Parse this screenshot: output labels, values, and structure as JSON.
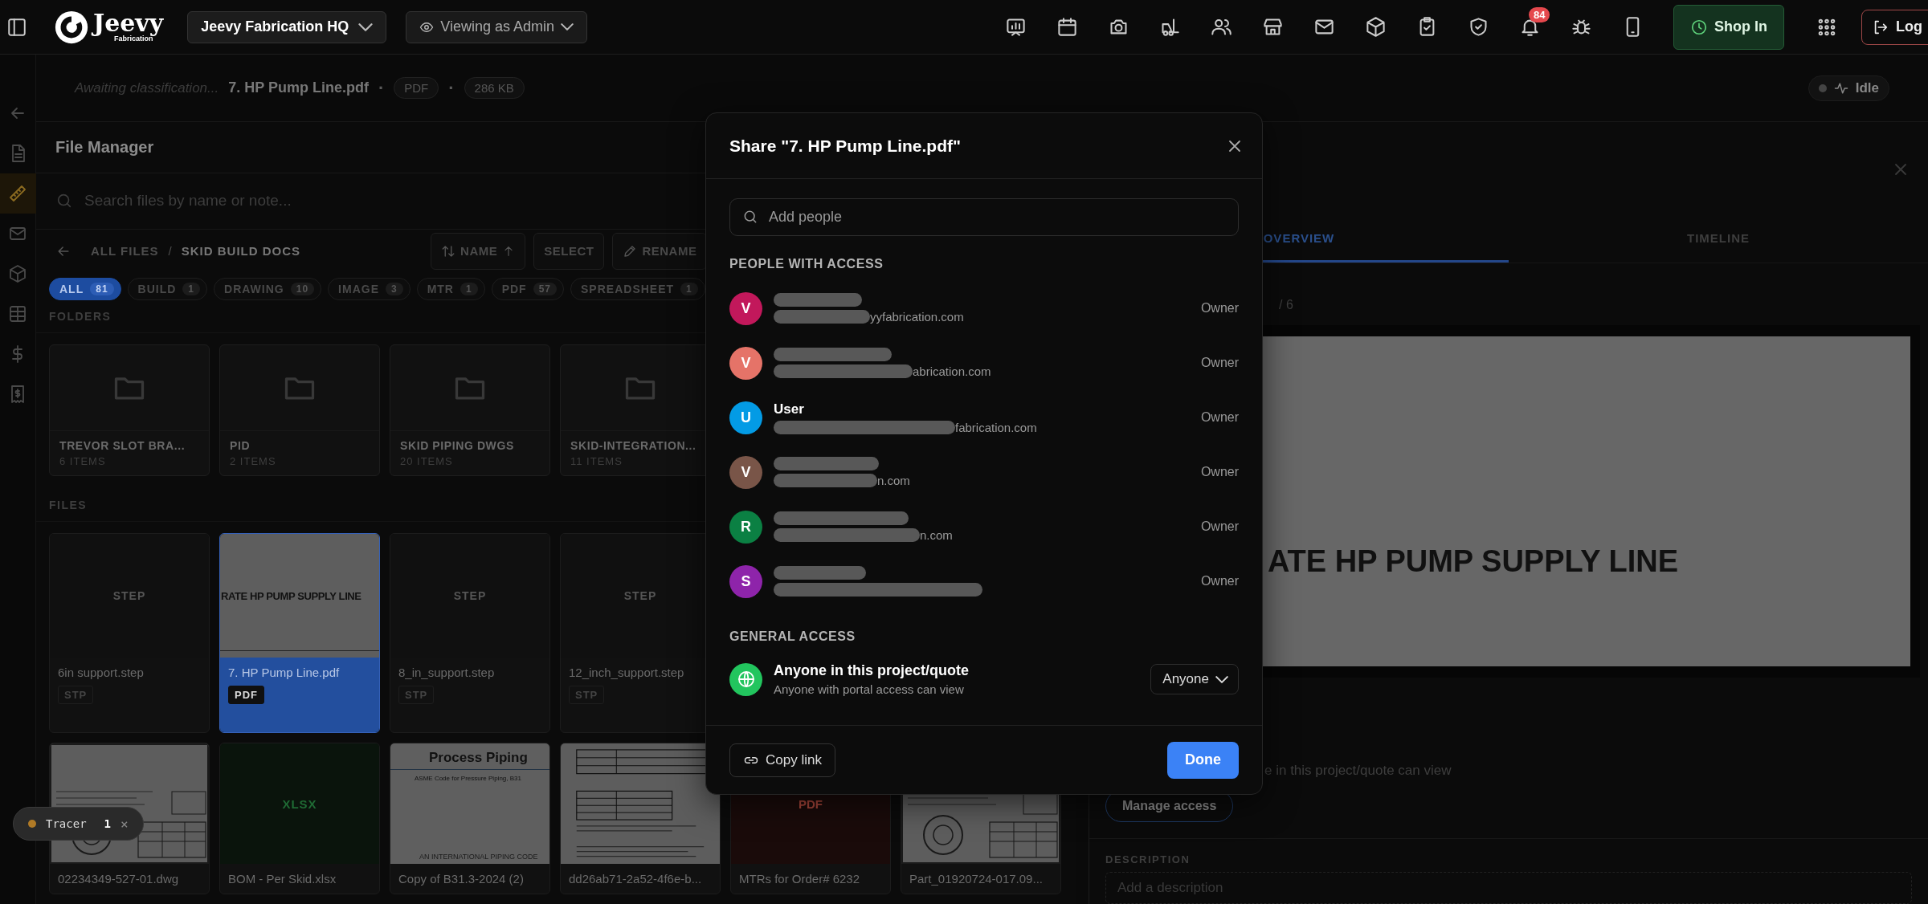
{
  "topbar": {
    "logo": {
      "name": "Jeevy",
      "subtitle": "Fabrication"
    },
    "workspace": "Jeevy Fabrication HQ",
    "view_as": "Viewing as Admin",
    "notification_count": "84",
    "shop_button": "Shop In",
    "logout_button": "Log"
  },
  "rail": {
    "items": [
      {
        "selected": false
      },
      {
        "selected": false
      },
      {
        "selected": true
      },
      {
        "selected": false
      },
      {
        "selected": false
      },
      {
        "selected": false
      },
      {
        "selected": false
      },
      {
        "selected": false
      }
    ]
  },
  "file_header": {
    "status": "Awaiting classification...",
    "file_name": "7. HP Pump Line.pdf",
    "separator_1": "·",
    "type": "PDF",
    "separator_2": "·",
    "size": "286 KB",
    "activity": "Idle"
  },
  "file_manager": {
    "title": "File Manager",
    "search": {
      "placeholder": "Search files by name or note..."
    },
    "breadcrumb": {
      "root": "ALL FILES",
      "separator": "/",
      "current": "SKID BUILD DOCS"
    },
    "toolbar": [
      {
        "label": "NAME",
        "kind": "sort"
      },
      {
        "label": "SELECT",
        "kind": "plain"
      },
      {
        "label": "RENAME",
        "kind": "edit"
      }
    ],
    "filters": [
      {
        "label": "ALL",
        "count": "81",
        "selected": true
      },
      {
        "label": "BUILD",
        "count": "1",
        "selected": false
      },
      {
        "label": "DRAWING",
        "count": "10",
        "selected": false
      },
      {
        "label": "IMAGE",
        "count": "3",
        "selected": false
      },
      {
        "label": "MTR",
        "count": "1",
        "selected": false
      },
      {
        "label": "PDF",
        "count": "57",
        "selected": false
      },
      {
        "label": "SPREADSHEET",
        "count": "1",
        "selected": false
      }
    ],
    "folders_heading": "FOLDERS",
    "folders": [
      {
        "name": "TREVOR SLOT BRA...",
        "count": "6 ITEMS"
      },
      {
        "name": "PID",
        "count": "2 ITEMS"
      },
      {
        "name": "SKID PIPING DWGS",
        "count": "20 ITEMS"
      },
      {
        "name": "SKID-INTEGRATION...",
        "count": "11 ITEMS"
      }
    ],
    "files_heading": "FILES",
    "file_rows": [
      [
        {
          "name": "6in support.step",
          "type": "STP",
          "kind": "step",
          "thumb_text": "STEP",
          "selected": false
        },
        {
          "name": "7. HP Pump Line.pdf",
          "type": "PDF",
          "kind": "title_page",
          "thumb_text": "RATE HP PUMP SUPPLY LINE",
          "selected": true
        },
        {
          "name": "8_in_support.step",
          "type": "STP",
          "kind": "step",
          "thumb_text": "STEP",
          "selected": false
        },
        {
          "name": "12_inch_support.step",
          "type": "STP",
          "kind": "step",
          "thumb_text": "STEP",
          "selected": false
        }
      ],
      [
        {
          "name": "02234349-527-01.dwg",
          "kind": "drawing",
          "selected": false
        },
        {
          "name": "BOM - Per Skid.xlsx",
          "kind": "sheet",
          "thumb_text": "XLSX",
          "selected": false
        },
        {
          "name": "Copy of B31.3-2024 (2)",
          "kind": "cover",
          "thumb_title": "Process Piping",
          "thumb_subtitle": "ASME Code for Pressure Piping, B31",
          "thumb_footer": "AN INTERNATIONAL PIPING CODE",
          "selected": false
        },
        {
          "name": "dd26ab71-2a52-4f6e-b...",
          "kind": "form",
          "selected": false
        },
        {
          "name": "MTRs for Order# 6232",
          "kind": "pdf",
          "thumb_text": "PDF",
          "selected": false
        },
        {
          "name": "Part_01920724-017.09...",
          "kind": "drawing",
          "selected": false
        }
      ]
    ]
  },
  "detail": {
    "tabs": [
      {
        "label": "OVERVIEW",
        "selected": true
      },
      {
        "label": "TIMELINE",
        "selected": false
      }
    ],
    "page_total": "/ 6",
    "preview_text": "ATE HP PUMP SUPPLY LINE",
    "access_note": "e in this project/quote can view",
    "manage_button": "Manage access",
    "description": {
      "label": "DESCRIPTION",
      "placeholder": "Add a description"
    }
  },
  "share_dialog": {
    "title": "Share \"7. HP Pump Line.pdf\"",
    "search": {
      "placeholder": "Add people"
    },
    "people_heading": "PEOPLE WITH ACCESS",
    "people": [
      {
        "initial": "V",
        "color": "#c2185b",
        "name_redacted": true,
        "email": "yyfabrication.com",
        "email_redacted": true,
        "role": "Owner"
      },
      {
        "initial": "V",
        "color": "#e57368",
        "name_redacted": true,
        "email": "abrication.com",
        "email_redacted": true,
        "role": "Owner"
      },
      {
        "initial": "U",
        "color": "#039be5",
        "name": "User",
        "name_redacted": false,
        "email": "fabrication.com",
        "email_redacted": true,
        "role": "Owner"
      },
      {
        "initial": "V",
        "color": "#795548",
        "name_redacted": true,
        "email": "n.com",
        "email_redacted": true,
        "role": "Owner"
      },
      {
        "initial": "R",
        "color": "#0b8043",
        "name_redacted": true,
        "email": "n.com",
        "email_redacted": true,
        "role": "Owner"
      },
      {
        "initial": "S",
        "color": "#8e24aa",
        "name_redacted": true,
        "email_redacted": true,
        "role": "Owner"
      }
    ],
    "general_heading": "GENERAL ACCESS",
    "general": {
      "title": "Anyone in this project/quote",
      "subtitle": "Anyone with portal access can view",
      "level": "Anyone"
    },
    "copy_button": "Copy link",
    "done_button": "Done"
  },
  "tracer": {
    "label": "Tracer",
    "count": "1",
    "close": "×"
  }
}
